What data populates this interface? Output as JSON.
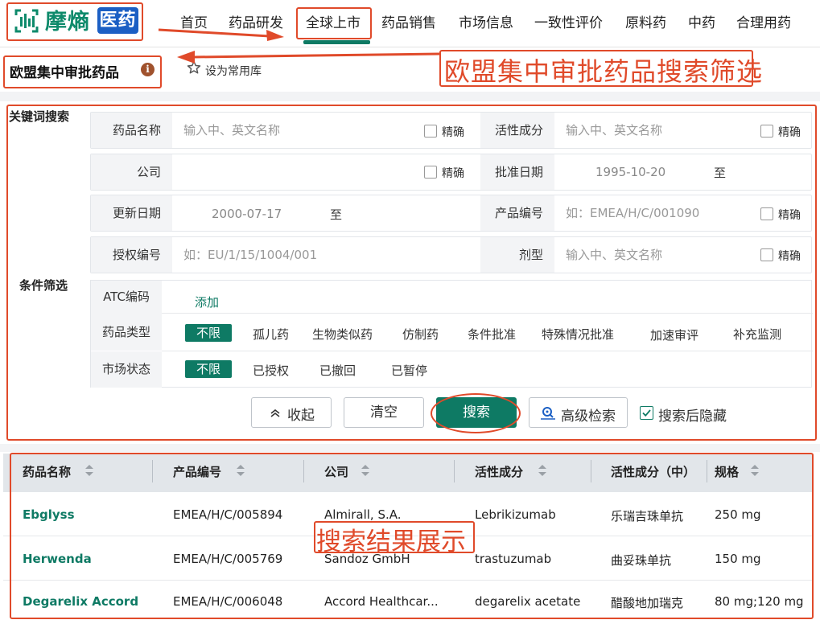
{
  "brand": {
    "name": "摩熵",
    "badge": "医药"
  },
  "nav": [
    "首页",
    "药品研发",
    "全球上市",
    "药品销售",
    "市场信息",
    "一致性评价",
    "原料药",
    "中药",
    "合理用药"
  ],
  "nav_active": "全球上市",
  "page": {
    "title": "欧盟集中审批药品",
    "fav_label": "设为常用库"
  },
  "annotations": {
    "top": "欧盟集中审批药品搜索筛选",
    "results": "搜索结果展示"
  },
  "search": {
    "keyword_label": "关键词搜索",
    "condition_label": "条件筛选",
    "exact_label": "精确",
    "to_label": "至",
    "drug_name": {
      "label": "药品名称",
      "placeholder": "输入中、英文名称"
    },
    "active_ingredient": {
      "label": "活性成分",
      "placeholder": "输入中、英文名称"
    },
    "company": {
      "label": "公司",
      "placeholder": ""
    },
    "approval_date": {
      "label": "批准日期",
      "from": "1995-10-20"
    },
    "update_date": {
      "label": "更新日期",
      "from": "2000-07-17"
    },
    "product_no": {
      "label": "产品编号",
      "placeholder": "如：EMEA/H/C/001090"
    },
    "auth_no": {
      "label": "授权编号",
      "placeholder": "如：EU/1/15/1004/001"
    },
    "dosage_form": {
      "label": "剂型",
      "placeholder": "输入中、英文名称"
    }
  },
  "filters": {
    "atc": {
      "label": "ATC编码",
      "add": "添加"
    },
    "drug_type": {
      "label": "药品类型",
      "options": [
        "不限",
        "孤儿药",
        "生物类似药",
        "仿制药",
        "条件批准",
        "特殊情况批准",
        "加速审评",
        "补充监测"
      ]
    },
    "market_status": {
      "label": "市场状态",
      "options": [
        "不限",
        "已授权",
        "已撤回",
        "已暂停"
      ]
    }
  },
  "buttons": {
    "collapse": "收起",
    "clear": "清空",
    "search": "搜索",
    "advanced": "高级检索",
    "hide_after": "搜索后隐藏"
  },
  "table": {
    "columns": [
      "药品名称",
      "产品编号",
      "公司",
      "活性成分",
      "活性成分（中）",
      "规格"
    ],
    "rows": [
      [
        "Ebglyss",
        "EMEA/H/C/005894",
        "Almirall, S.A.",
        "Lebrikizumab",
        "乐瑞吉珠单抗",
        "250 mg"
      ],
      [
        "Herwenda",
        "EMEA/H/C/005769",
        "Sandoz GmbH",
        "trastuzumab",
        "曲妥珠单抗",
        "150 mg"
      ],
      [
        "Degarelix Accord",
        "EMEA/H/C/006048",
        "Accord Healthcar...",
        "degarelix acetate",
        "醋酸地加瑞克",
        "80 mg;120 mg"
      ]
    ]
  },
  "colors": {
    "brand_green": "#0e7a64",
    "badge_blue": "#1b5fc4",
    "annotation_red": "#e04a2a"
  }
}
